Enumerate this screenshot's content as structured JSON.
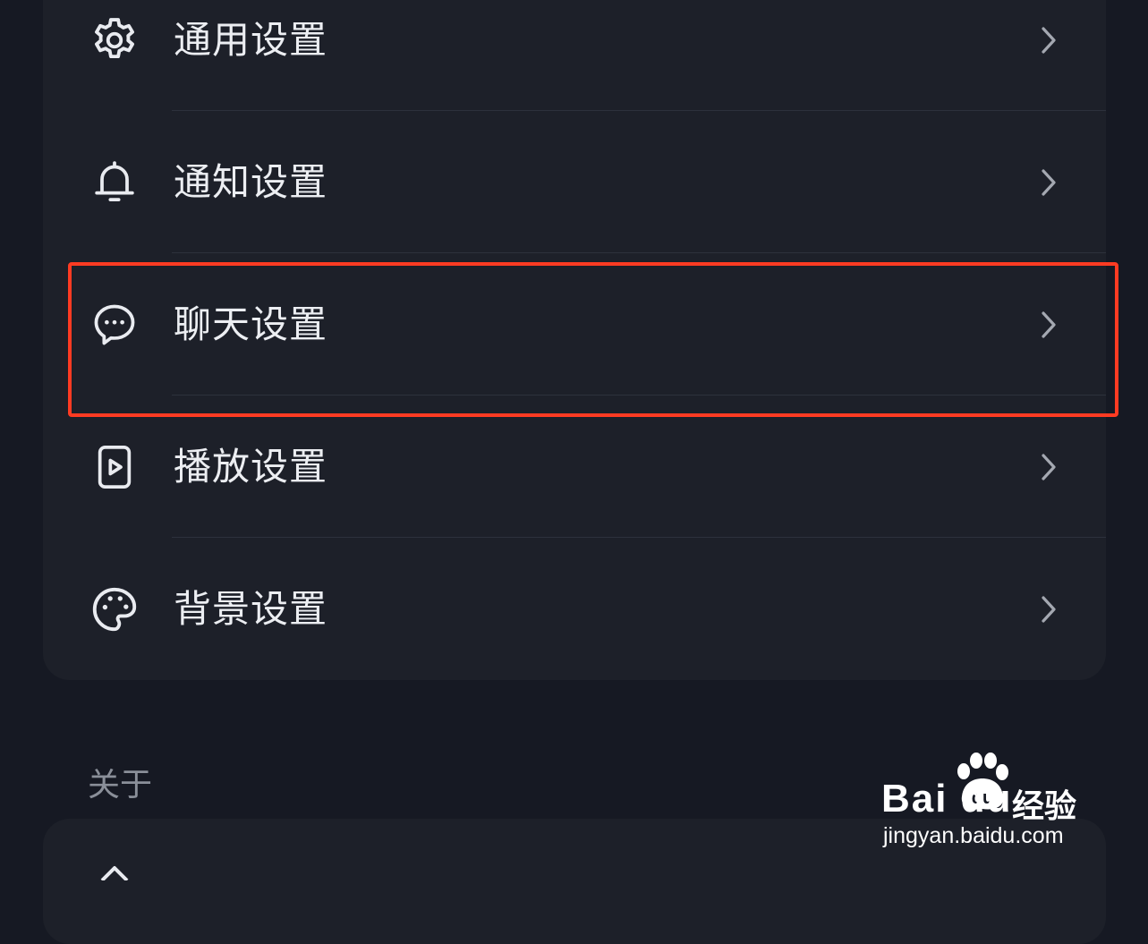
{
  "settings_list": [
    {
      "label": "通用设置",
      "icon": "gear-icon"
    },
    {
      "label": "通知设置",
      "icon": "bell-icon"
    },
    {
      "label": "聊天设置",
      "icon": "chat-bubble-icon"
    },
    {
      "label": "播放设置",
      "icon": "play-icon"
    },
    {
      "label": "背景设置",
      "icon": "palette-icon"
    }
  ],
  "about_section": {
    "title": "关于"
  },
  "watermark": {
    "brand": "Bai du",
    "brand_cn": "经验",
    "url": "jingyan.baidu.com"
  },
  "colors": {
    "highlight": "#ff3b22",
    "background": "#161923",
    "card": "#1d2029"
  }
}
